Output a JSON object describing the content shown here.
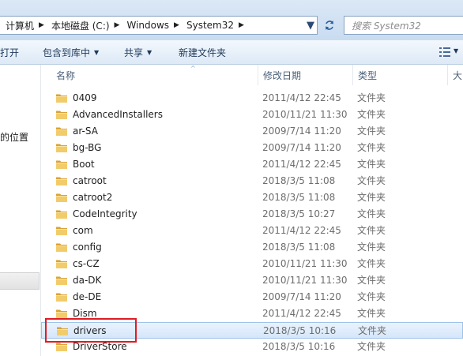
{
  "address_bar": {
    "crumbs": [
      "计算机",
      "本地磁盘 (C:)",
      "Windows",
      "System32"
    ],
    "search_placeholder": "搜索 System32"
  },
  "toolbar": {
    "open_label": "打开",
    "include_label": "包含到库中",
    "share_label": "共享",
    "new_folder_label": "新建文件夹"
  },
  "nav_pane": {
    "partial_label": "的位置"
  },
  "columns": {
    "name": "名称",
    "date": "修改日期",
    "type": "类型",
    "size": "大"
  },
  "files": [
    {
      "name": "0409",
      "date": "2011/4/12 22:45",
      "type": "文件夹"
    },
    {
      "name": "AdvancedInstallers",
      "date": "2010/11/21 11:30",
      "type": "文件夹"
    },
    {
      "name": "ar-SA",
      "date": "2009/7/14 11:20",
      "type": "文件夹"
    },
    {
      "name": "bg-BG",
      "date": "2009/7/14 11:20",
      "type": "文件夹"
    },
    {
      "name": "Boot",
      "date": "2011/4/12 22:45",
      "type": "文件夹"
    },
    {
      "name": "catroot",
      "date": "2018/3/5 11:08",
      "type": "文件夹"
    },
    {
      "name": "catroot2",
      "date": "2018/3/5 11:08",
      "type": "文件夹"
    },
    {
      "name": "CodeIntegrity",
      "date": "2018/3/5 10:27",
      "type": "文件夹"
    },
    {
      "name": "com",
      "date": "2011/4/12 22:45",
      "type": "文件夹"
    },
    {
      "name": "config",
      "date": "2018/3/5 11:08",
      "type": "文件夹"
    },
    {
      "name": "cs-CZ",
      "date": "2010/11/21 11:30",
      "type": "文件夹"
    },
    {
      "name": "da-DK",
      "date": "2010/11/21 11:30",
      "type": "文件夹"
    },
    {
      "name": "de-DE",
      "date": "2009/7/14 11:20",
      "type": "文件夹"
    },
    {
      "name": "Dism",
      "date": "2011/4/12 22:45",
      "type": "文件夹"
    },
    {
      "name": "drivers",
      "date": "2018/3/5 10:16",
      "type": "文件夹",
      "selected": true
    },
    {
      "name": "DriverStore",
      "date": "2018/3/5 10:16",
      "type": "文件夹"
    }
  ],
  "icons": {
    "folder": "folder-icon",
    "refresh": "refresh-icon",
    "dropdown": "chevron-down-icon",
    "view": "view-options-icon"
  },
  "colors": {
    "highlight_border": "#e21b23",
    "selection_fill": "#d5e6fa",
    "folder": "#e8b84a"
  }
}
